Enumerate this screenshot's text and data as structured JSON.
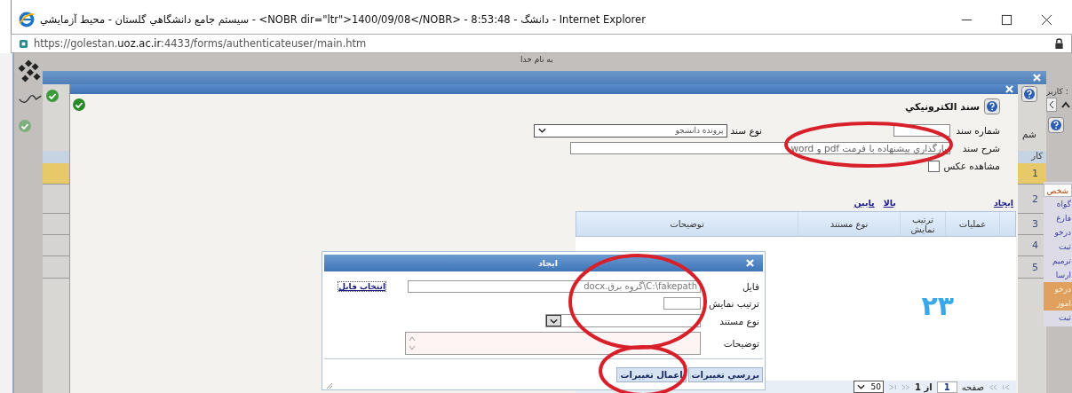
{
  "browser": {
    "title": "سيستم جامع دانشگاهي گلستان - محيط آزمايشي - <NOBR dir=\"ltr\">1400/09/08</NOBR> - 8:53:48 - دانشگ - Internet Explorer",
    "address": "https://golestan.**uoz.ac.ir**:4433/forms/authenticateuser/main.htm"
  },
  "page": {
    "header": "به نام خدا",
    "user_label": "كاربر :",
    "menu_items": [
      {
        "label": "شخص",
        "selected": true,
        "highlighted": false
      },
      {
        "label": "گواه",
        "selected": false,
        "highlighted": false
      },
      {
        "label": "فارغ",
        "selected": false,
        "highlighted": false
      },
      {
        "label": "درخو",
        "selected": false,
        "highlighted": false
      },
      {
        "label": "ثبت",
        "selected": false,
        "highlighted": false
      },
      {
        "label": "ترميم",
        "selected": false,
        "highlighted": false
      },
      {
        "label": "ارسا",
        "selected": false,
        "highlighted": false
      },
      {
        "label": "درخو",
        "selected": false,
        "highlighted": true
      },
      {
        "label": "اموز",
        "selected": false,
        "highlighted": true
      },
      {
        "label": "ثبت",
        "selected": false,
        "highlighted": false
      }
    ]
  },
  "outer_window": {
    "label_fragment": "شم",
    "column_header": "كار",
    "rows": [
      {
        "number": "1",
        "selected": true
      },
      {
        "number": "2",
        "selected": false
      },
      {
        "number": "3",
        "selected": false
      },
      {
        "number": "4",
        "selected": false
      },
      {
        "number": "5",
        "selected": false
      }
    ]
  },
  "document_window": {
    "title": "سند الكترونيكي",
    "doc_number": {
      "label": "شماره سند"
    },
    "doc_type": {
      "label": "نوع سند",
      "value": "پرونده دانشجو"
    },
    "description": {
      "label": "شرح سند",
      "value": "بارگذاري پيشنهاده با فرمت pdf و word"
    },
    "show_photo": {
      "label": "مشاهده عكس",
      "checked": false
    },
    "links": [
      "ايجاد",
      "بالا",
      "پايين"
    ],
    "columns": [
      "عمليات",
      "ترتيب نمايش",
      "نوع مستند",
      "توضيحات"
    ],
    "annotation": "۲۳",
    "pager": {
      "page_label": "صفحه",
      "page": "1",
      "of": "از 1",
      "page_size": "50"
    }
  },
  "create_dialog": {
    "title": "ايجاد",
    "file_label": "فايل",
    "file_value": "C:\\fakepath\\گروه برق.docx",
    "choose_file": "انتخاب فايل",
    "order_label": "ترتيب نمايش",
    "type_label": "نوع مستند",
    "notes_label": "توضيحات",
    "buttons": [
      "بررسي تغييرات",
      "اعمال تغييرات"
    ]
  }
}
